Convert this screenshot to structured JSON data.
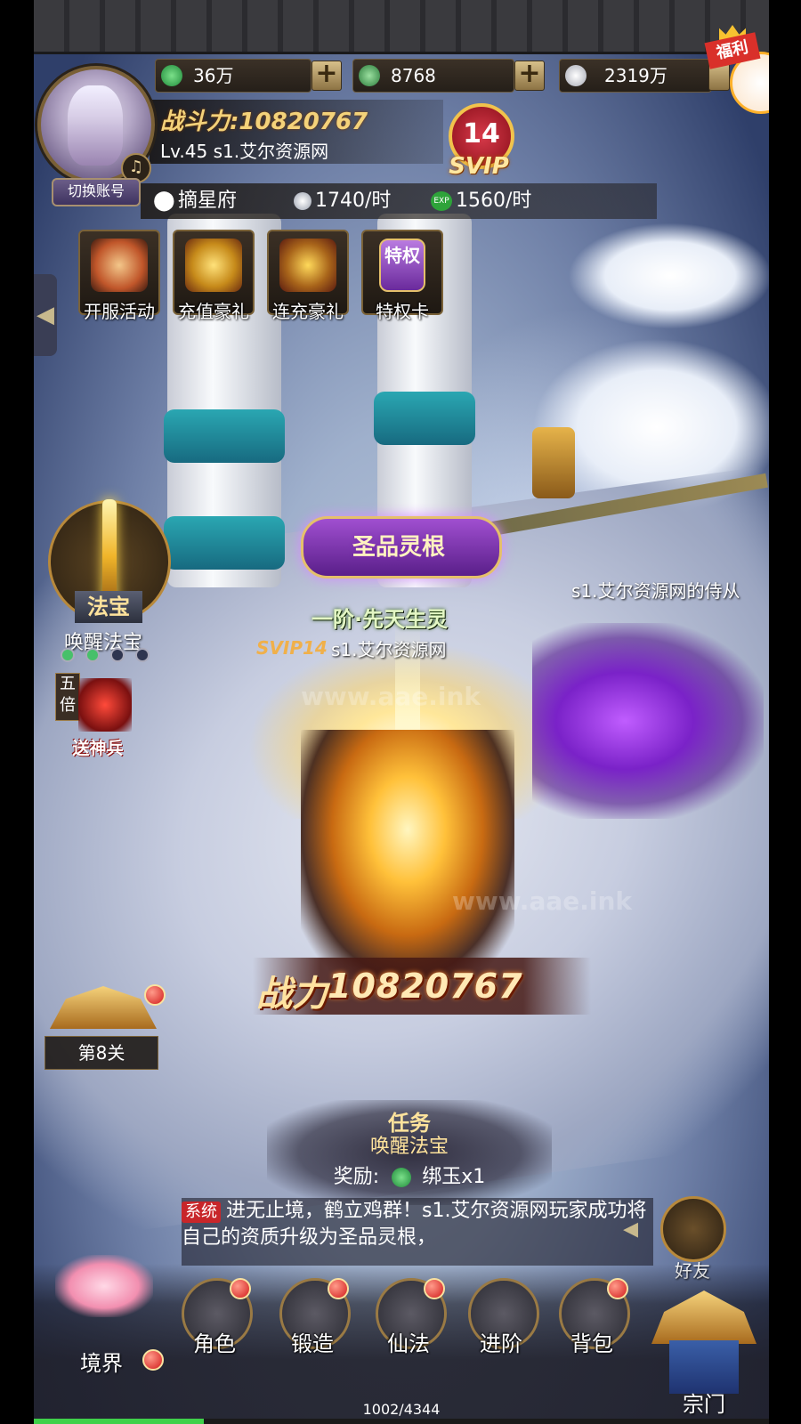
{
  "resources": {
    "jade": "36万",
    "bound_jade": "8768",
    "coins": "2319万"
  },
  "player": {
    "power_label": "战斗力:10820767",
    "level_server_name": "Lv.45 s1.艾尔资源网",
    "switch_account": "切换账号",
    "svip_level": "14",
    "svip_label": "SVIP"
  },
  "location": {
    "name": "摘星府",
    "silver_rate": "1740/时",
    "exp_icon": "EXP",
    "exp_rate": "1560/时"
  },
  "events": [
    {
      "label": "开服活动",
      "icon": "horn-icon"
    },
    {
      "label": "充值豪礼",
      "icon": "treasure-chest-icon"
    },
    {
      "label": "连充豪礼",
      "icon": "gold-chest-icon"
    },
    {
      "label": "特权卡",
      "icon": "privilege-card-icon",
      "card_text": "特权"
    }
  ],
  "welfare": {
    "label": "福利"
  },
  "left_panel": {
    "fabao_title": "法宝",
    "fabao_subtitle": "唤醒法宝",
    "fabao_dots": [
      true,
      true,
      false,
      false
    ],
    "wubei_badge": "五倍",
    "wubei_label": "送神兵",
    "stage_label": "第8关"
  },
  "scene": {
    "root_badge": "圣品灵根",
    "root_grade": "一阶·先天生灵",
    "player_svip": "SVIP14",
    "player_name": "s1.艾尔资源网",
    "pet_name": "s1.艾尔资源网的侍从",
    "power_label": "战力",
    "power_value": "10820767",
    "watermark": "www.aae.ink"
  },
  "quest": {
    "title": "任务",
    "name": "唤醒法宝",
    "reward_label": "奖励:",
    "reward_item": "绑玉x1"
  },
  "chat": {
    "tag": "系统",
    "message": "进无止境，鹤立鸡群！s1.艾尔资源网玩家成功将自己的资质升级为圣品灵根，"
  },
  "friends_label": "好友",
  "bottom_nav": [
    {
      "label": "境界",
      "icon": "lotus-icon"
    },
    {
      "label": "角色",
      "icon": "character-icon"
    },
    {
      "label": "锻造",
      "icon": "crossed-swords-icon"
    },
    {
      "label": "仙法",
      "icon": "lotus-magic-icon"
    },
    {
      "label": "进阶",
      "icon": "yin-yang-icon"
    },
    {
      "label": "背包",
      "icon": "backpack-icon"
    },
    {
      "label": "宗门",
      "icon": "sect-gate-icon"
    }
  ],
  "experience": {
    "text": "1002/4344",
    "progress": 0.2307
  }
}
